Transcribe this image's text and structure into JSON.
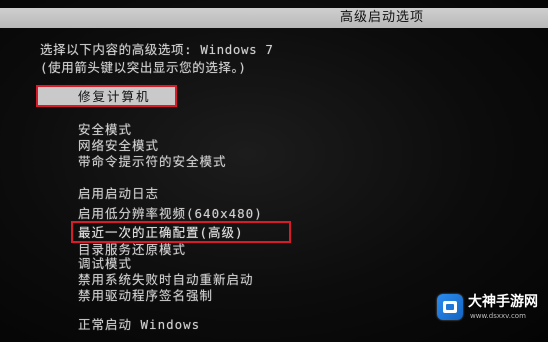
{
  "window": {
    "title": "高级启动选项"
  },
  "prompt": {
    "line1": "选择以下内容的高级选项: Windows 7",
    "line2": "(使用箭头键以突出显示您的选择。)"
  },
  "menu": {
    "selected": "修复计算机",
    "items": [
      "安全模式",
      "网络安全模式",
      "带命令提示符的安全模式",
      "启用启动日志",
      "启用低分辨率视频(640x480)",
      "最近一次的正确配置(高级)",
      "目录服务还原模式",
      "调试模式",
      "禁用系统失败时自动重新启动",
      "禁用驱动程序签名强制",
      "正常启动 Windows"
    ]
  },
  "watermark": {
    "name": "大神手游网",
    "url": "www.dsxxv.com",
    "icon": "gamepad-logo-icon"
  },
  "colors": {
    "background": "#0c0c0c",
    "title_bar": "#c4c4c4",
    "text": "#d2d2d2",
    "annotation": "#d81b2a",
    "brand": "#1e78d8"
  }
}
